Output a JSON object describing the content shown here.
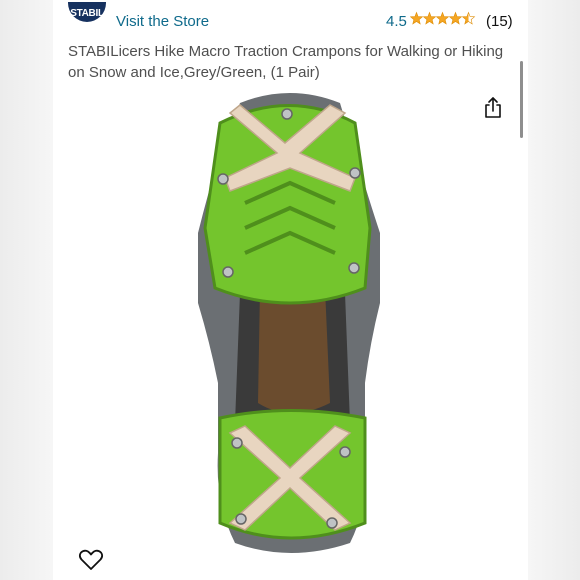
{
  "header": {
    "brand_logo_text": "STABIL",
    "visit_store_label": "Visit the Store",
    "rating_value": "4.5",
    "rating_count": "(15)"
  },
  "product": {
    "title": "STABILicers Hike Macro Traction Crampons for Walking or Hiking on Snow and Ice,Grey/Green, (1 Pair)"
  },
  "icons": {
    "share": "share-icon",
    "wishlist": "heart-icon",
    "rating": "star-rating-icon"
  },
  "colors": {
    "link": "#0f6a8b",
    "star": "#f5a623",
    "brand": "#16315f",
    "product_green": "#74c52d"
  }
}
